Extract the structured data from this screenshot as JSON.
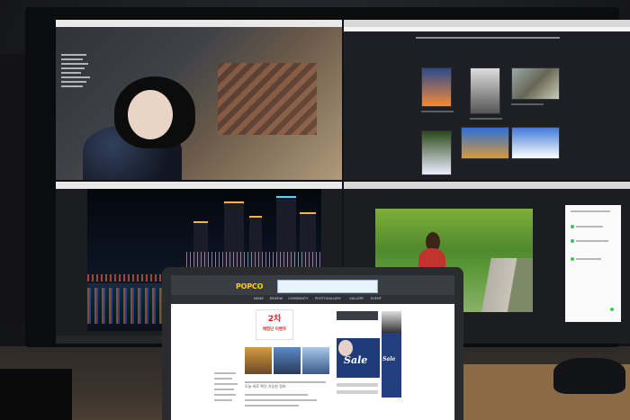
{
  "laptop": {
    "logo": "POPCO",
    "nav": [
      "NEWS",
      "REVIEW",
      "COMMUNITY",
      "PHOTOGALLERY",
      "GALLERY",
      "EVENT"
    ],
    "hero_number": "2차",
    "hero_sub": "체험단 이벤트",
    "sale_label": "Sale",
    "sale_label_2": "Sale",
    "search_hint": "오늘 바로 확인 가능한 정보"
  },
  "colors": {
    "accent_red": "#e3262a",
    "popco_yellow": "#ffd000",
    "sale_blue": "#1f3c78",
    "status_green": "#3ac84a"
  }
}
